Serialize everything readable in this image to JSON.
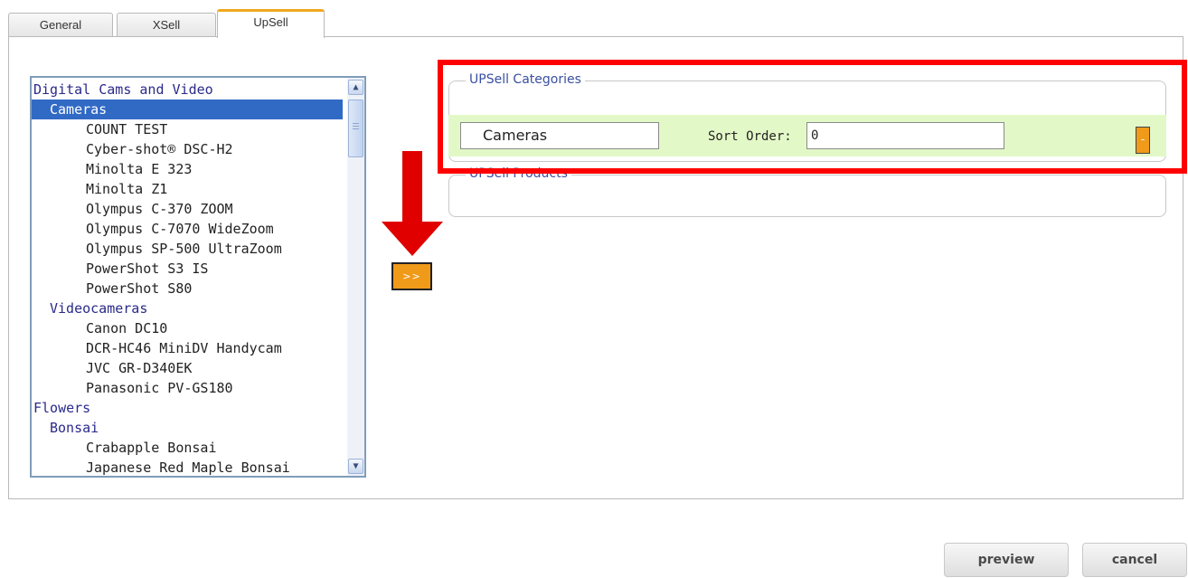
{
  "tabs": [
    {
      "label": "General"
    },
    {
      "label": "XSell"
    },
    {
      "label": "UpSell"
    }
  ],
  "category_list": {
    "items": [
      {
        "label": "Digital Cams and Video",
        "level": 0,
        "selected": false
      },
      {
        "label": "Cameras",
        "level": 1,
        "selected": true
      },
      {
        "label": "COUNT TEST",
        "level": 2,
        "selected": false
      },
      {
        "label": "Cyber-shot® DSC-H2",
        "level": 2,
        "selected": false
      },
      {
        "label": "Minolta E 323",
        "level": 2,
        "selected": false
      },
      {
        "label": "Minolta Z1",
        "level": 2,
        "selected": false
      },
      {
        "label": "Olympus C-370 ZOOM",
        "level": 2,
        "selected": false
      },
      {
        "label": "Olympus C-7070 WideZoom",
        "level": 2,
        "selected": false
      },
      {
        "label": "Olympus SP-500 UltraZoom",
        "level": 2,
        "selected": false
      },
      {
        "label": "PowerShot S3 IS",
        "level": 2,
        "selected": false
      },
      {
        "label": "PowerShot S80",
        "level": 2,
        "selected": false
      },
      {
        "label": "Videocameras",
        "level": 1,
        "selected": false
      },
      {
        "label": "Canon DC10",
        "level": 2,
        "selected": false
      },
      {
        "label": "DCR-HC46 MiniDV Handycam",
        "level": 2,
        "selected": false
      },
      {
        "label": "JVC GR-D340EK",
        "level": 2,
        "selected": false
      },
      {
        "label": "Panasonic PV-GS180",
        "level": 2,
        "selected": false
      },
      {
        "label": "Flowers",
        "level": 0,
        "selected": false
      },
      {
        "label": "Bonsai",
        "level": 1,
        "selected": false
      },
      {
        "label": "Crabapple Bonsai",
        "level": 2,
        "selected": false
      },
      {
        "label": "Japanese Red Maple Bonsai",
        "level": 2,
        "selected": false
      }
    ]
  },
  "add_button": {
    "label": ">>"
  },
  "upsell_categories": {
    "legend": "UPSell Categories",
    "rows": [
      {
        "category": "Cameras",
        "sort_label": "Sort Order:",
        "sort_value": "0",
        "remove_label": "-"
      }
    ]
  },
  "upsell_products": {
    "legend": "UPSell Products"
  },
  "buttons": {
    "preview": "preview",
    "cancel": "cancel"
  },
  "colors": {
    "accent": "#f09a1a",
    "selection": "#316ac5",
    "highlight_box": "#ff0000",
    "arrow": "#e00000",
    "category_row_bg": "#e3f8c7"
  }
}
